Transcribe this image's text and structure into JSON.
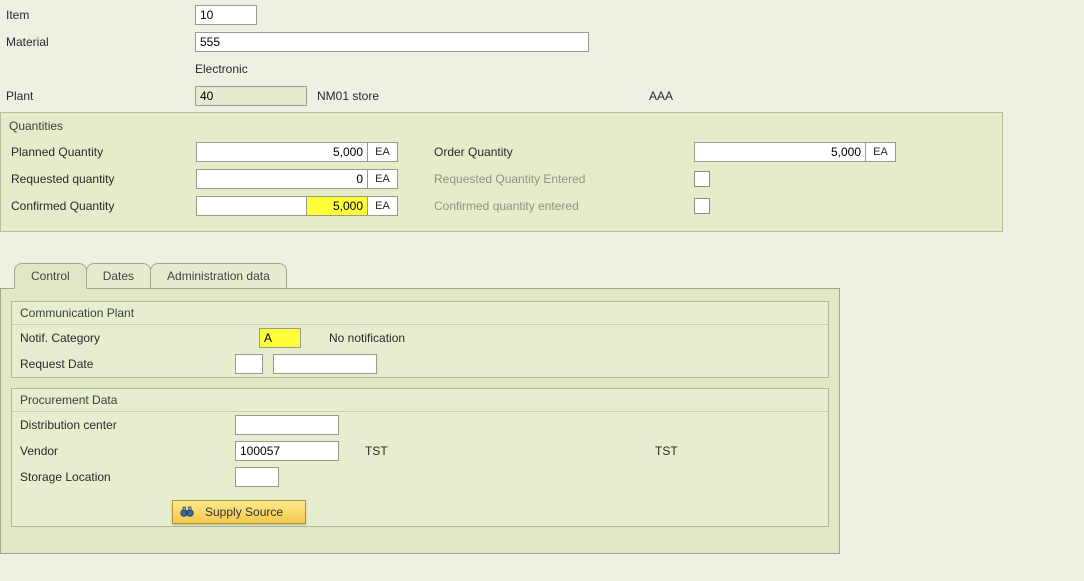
{
  "header": {
    "item_label": "Item",
    "item_value": "10",
    "material_label": "Material",
    "material_value": "555",
    "material_desc": "Electronic",
    "plant_label": "Plant",
    "plant_value": "40",
    "plant_desc": "NM01 store",
    "plant_extra": "AAA"
  },
  "quantities": {
    "title": "Quantities",
    "planned_label": "Planned Quantity",
    "planned_value": "5,000",
    "planned_unit": "EA",
    "requested_label": "Requested quantity",
    "requested_value": "0",
    "requested_unit": "EA",
    "confirmed_label": "Confirmed Quantity",
    "confirmed_value": "5,000",
    "confirmed_unit": "EA",
    "order_label": "Order Quantity",
    "order_value": "5,000",
    "order_unit": "EA",
    "req_entered_label": "Requested Quantity Entered",
    "conf_entered_label": "Confirmed quantity entered"
  },
  "tabs": {
    "control": "Control",
    "dates": "Dates",
    "admin": "Administration data"
  },
  "comm": {
    "title": "Communication Plant",
    "notif_label": "Notif. Category",
    "notif_value": "A",
    "notif_desc": "No notification",
    "reqdate_label": "Request Date",
    "reqdate_flag": "",
    "reqdate_value": ""
  },
  "proc": {
    "title": "Procurement Data",
    "dc_label": "Distribution center",
    "dc_value": "",
    "vendor_label": "Vendor",
    "vendor_value": "100057",
    "vendor_name": "TST",
    "vendor_name2": "TST",
    "stloc_label": "Storage Location",
    "stloc_value": ""
  },
  "buttons": {
    "supply_source": "Supply Source"
  }
}
